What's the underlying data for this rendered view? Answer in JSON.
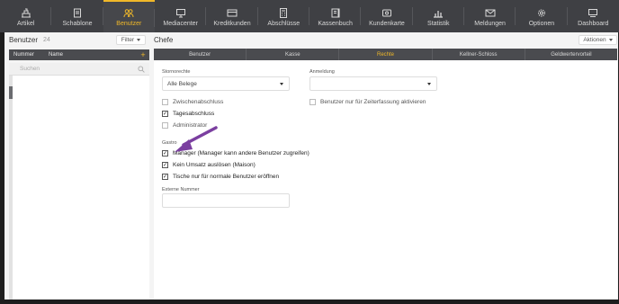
{
  "nav": [
    {
      "label": "Artikel",
      "icon": "cash-register-icon",
      "active": false
    },
    {
      "label": "Schablone",
      "icon": "template-icon",
      "active": false
    },
    {
      "label": "Benutzer",
      "icon": "users-icon",
      "active": true
    },
    {
      "label": "Mediacenter",
      "icon": "monitor-icon",
      "active": false
    },
    {
      "label": "Kreditkunden",
      "icon": "credit-card-icon",
      "active": false
    },
    {
      "label": "Abschlüsse",
      "icon": "calculator-icon",
      "active": false
    },
    {
      "label": "Kassenbuch",
      "icon": "book-icon",
      "active": false
    },
    {
      "label": "Kundenkarte",
      "icon": "customer-card-icon",
      "active": false
    },
    {
      "label": "Statistik",
      "icon": "chart-icon",
      "active": false
    },
    {
      "label": "Meldungen",
      "icon": "mail-icon",
      "active": false
    },
    {
      "label": "Optionen",
      "icon": "gear-icon",
      "active": false
    },
    {
      "label": "Dashboard",
      "icon": "dashboard-icon",
      "active": false
    }
  ],
  "left": {
    "title": "Benutzer",
    "count": "24",
    "filter_label": "Filter",
    "col_number": "Nummer",
    "col_name": "Name",
    "add": "+",
    "search_placeholder": "Suchen"
  },
  "right": {
    "title": "Chefe",
    "actions_label": "Aktionen",
    "tabs": [
      {
        "label": "Benutzer",
        "active": false
      },
      {
        "label": "Kasse",
        "active": false
      },
      {
        "label": "Rechte",
        "active": true
      },
      {
        "label": "Kellner-Schloss",
        "active": false
      },
      {
        "label": "Geldwertervorteil",
        "active": false
      }
    ],
    "storno_label": "Stornorechte",
    "storno_value": "Alle Belege",
    "anmeldung_label": "Anmeldung",
    "anmeldung_value": "",
    "checks_left": [
      {
        "label": "Zwischenabschluss",
        "checked": false
      },
      {
        "label": "Tagesabschluss",
        "checked": true
      },
      {
        "label": "Administrator",
        "checked": false
      }
    ],
    "check_right": {
      "label": "Benutzer nur für Zeiterfassung aktivieren",
      "checked": false
    },
    "gastro_label": "Gastro",
    "gastro_checks": [
      {
        "label": "Manager (Manager kann andere Benutzer zugreifen)",
        "checked": true
      },
      {
        "label": "Kein Umsatz auslösen (Maison)",
        "checked": true
      },
      {
        "label": "Tische nur für normale Benutzer eröffnen",
        "checked": true
      }
    ],
    "extern_label": "Externe Nummer",
    "extern_value": ""
  },
  "colors": {
    "accent": "#f0b829",
    "nav_bg": "#3f4044",
    "arrow": "#7b3fa0"
  }
}
